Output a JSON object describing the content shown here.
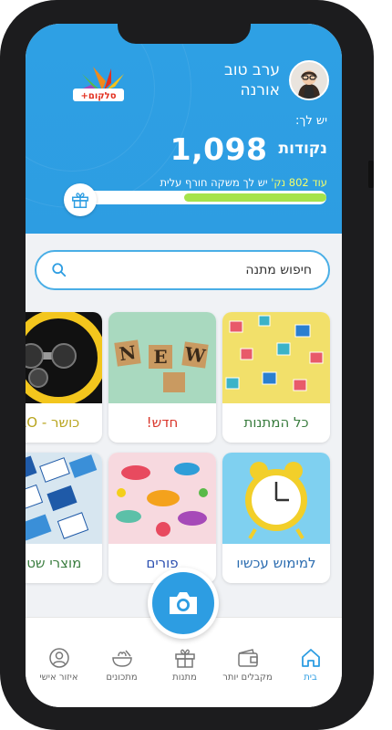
{
  "header": {
    "greeting_line1": "ערב טוב",
    "greeting_line2": "אורנה",
    "balance_label": "יש לך:",
    "points_value": "1,098",
    "points_label": "נקודות",
    "progress_prefix": "עוד 802 נק'",
    "progress_suffix": "יש לך משקה חורף עלית",
    "progress_fraction": 0.56,
    "logo_text": "+סלקום"
  },
  "search": {
    "placeholder": "חיפוש מתנה"
  },
  "categories": [
    {
      "label": "כל המתנות",
      "color": "#3a7d3f"
    },
    {
      "label": "חדש!",
      "color": "#d9362b"
    },
    {
      "label": "כושר - RO",
      "color": "#b8a41d"
    },
    {
      "label": "למימוש עכשיו",
      "color": "#2b6cb0"
    },
    {
      "label": "פורים",
      "color": "#2b4fb0"
    },
    {
      "label": "מוצרי שטרן",
      "color": "#3a7d3f"
    }
  ],
  "nav": [
    {
      "label": "בית",
      "icon": "home-icon"
    },
    {
      "label": "מקבלים יותר",
      "icon": "wallet-icon"
    },
    {
      "label": "מתנות",
      "icon": "gift-icon"
    },
    {
      "label": "מתכונים",
      "icon": "bowl-icon"
    },
    {
      "label": "איזור אישי",
      "icon": "user-icon"
    }
  ],
  "colors": {
    "accent": "#2d9de2",
    "progress": "#a6e34b"
  }
}
